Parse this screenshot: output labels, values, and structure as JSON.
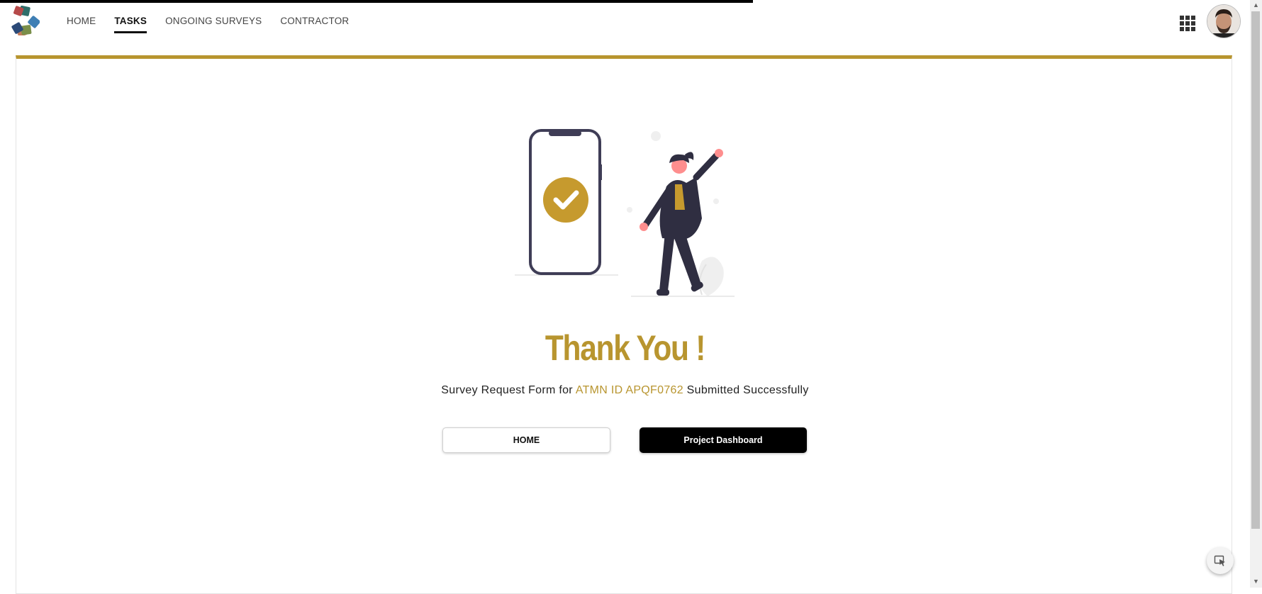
{
  "nav": {
    "items": [
      {
        "label": "HOME",
        "active": false
      },
      {
        "label": "TASKS",
        "active": true
      },
      {
        "label": "ONGOING SURVEYS",
        "active": false
      },
      {
        "label": "CONTRACTOR",
        "active": false
      }
    ]
  },
  "header": {
    "apps_icon": "apps-grid-icon",
    "avatar": "user-avatar"
  },
  "main": {
    "title": "Thank You !",
    "message_prefix": "Survey Request Form for",
    "message_highlight": "ATMN ID APQF0762",
    "message_suffix": "Submitted Successfully",
    "home_button": "HOME",
    "dashboard_button": "Project Dashboard"
  },
  "colors": {
    "accent": "#b8952f",
    "dark": "#000000"
  }
}
